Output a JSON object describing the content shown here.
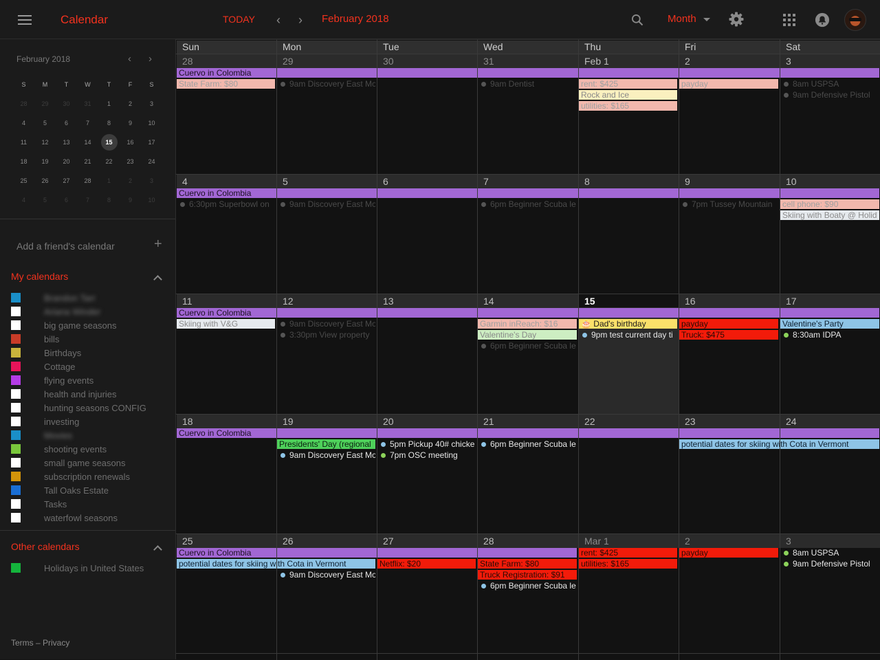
{
  "header": {
    "app_name": "Calendar",
    "today_label": "TODAY",
    "period": "February 2018",
    "view": "Month",
    "prev": "‹",
    "next": "›"
  },
  "mini": {
    "title": "February 2018",
    "weekdays": [
      "S",
      "M",
      "T",
      "W",
      "T",
      "F",
      "S"
    ],
    "weeks": [
      [
        "28",
        "29",
        "30",
        "31",
        "1",
        "2",
        "3"
      ],
      [
        "4",
        "5",
        "6",
        "7",
        "8",
        "9",
        "10"
      ],
      [
        "11",
        "12",
        "13",
        "14",
        "15",
        "16",
        "17"
      ],
      [
        "18",
        "19",
        "20",
        "21",
        "22",
        "23",
        "24"
      ],
      [
        "25",
        "26",
        "27",
        "28",
        "1",
        "2",
        "3"
      ],
      [
        "4",
        "5",
        "6",
        "7",
        "8",
        "9",
        "10"
      ]
    ],
    "selected": "15"
  },
  "sidebar": {
    "add_friend": "Add a friend's calendar",
    "my_calendars": "My calendars",
    "other_calendars": "Other calendars",
    "terms": "Terms – Privacy",
    "my": [
      {
        "label": "Brandon Tarr",
        "color": "#1a8fc8",
        "blurred": true
      },
      {
        "label": "Ariana Winder",
        "color": "#ffffff",
        "blurred": true
      },
      {
        "label": "big game seasons",
        "color": "#ffffff"
      },
      {
        "label": "bills",
        "color": "#c83c28"
      },
      {
        "label": "Birthdays",
        "color": "#c8b43c"
      },
      {
        "label": "Cottage",
        "color": "#e8145a"
      },
      {
        "label": "flying events",
        "color": "#b43ce6"
      },
      {
        "label": "health and injuries",
        "color": "#ffffff"
      },
      {
        "label": "hunting seasons CONFIG",
        "color": "#ffffff"
      },
      {
        "label": "investing",
        "color": "#ffffff"
      },
      {
        "label": "Movies",
        "color": "#1a8fc8",
        "blurred": true
      },
      {
        "label": "shooting events",
        "color": "#7ac83c"
      },
      {
        "label": "small game seasons",
        "color": "#ffffff"
      },
      {
        "label": "subscription renewals",
        "color": "#d4940a"
      },
      {
        "label": "Tall Oaks Estate",
        "color": "#1a6ed4"
      },
      {
        "label": "Tasks",
        "color": "#ffffff"
      },
      {
        "label": "waterfowl seasons",
        "color": "#ffffff"
      }
    ],
    "other": [
      {
        "label": "Holidays in United States",
        "color": "#14b43c"
      }
    ]
  },
  "grid": {
    "day_names": [
      "Sun",
      "Mon",
      "Tue",
      "Wed",
      "Thu",
      "Fri",
      "Sat"
    ],
    "weeks": [
      {
        "days": [
          "28",
          "29",
          "30",
          "31",
          "Feb 1",
          "2",
          "3"
        ],
        "dim": [
          true,
          true,
          true,
          true,
          false,
          false,
          false
        ],
        "events": [
          {
            "row": 0,
            "start": 0,
            "span": 7,
            "text": "Cuervo in Colombia",
            "style": "purple"
          },
          {
            "row": 1,
            "start": 0,
            "span": 1,
            "text": "State Farm: $80",
            "style": "pinkpast"
          },
          {
            "row": 1,
            "start": 1,
            "span": 1,
            "text": "9am Discovery East Mo",
            "style": "dotpast",
            "dot": "#555"
          },
          {
            "row": 1,
            "start": 3,
            "span": 1,
            "text": "9am Dentist",
            "style": "dotpast",
            "dot": "#555"
          },
          {
            "row": 1,
            "start": 4,
            "span": 1,
            "text": "rent: $425",
            "style": "pinkpast"
          },
          {
            "row": 2,
            "start": 4,
            "span": 1,
            "text": "Rock and Ice",
            "style": "yellowpast"
          },
          {
            "row": 3,
            "start": 4,
            "span": 1,
            "text": "utilities: $165",
            "style": "pinkpast"
          },
          {
            "row": 1,
            "start": 5,
            "span": 1,
            "text": "payday",
            "style": "pinkpast"
          },
          {
            "row": 1,
            "start": 6,
            "span": 1,
            "text": "8am USPSA",
            "style": "dotpast",
            "dot": "#555"
          },
          {
            "row": 2,
            "start": 6,
            "span": 1,
            "text": "9am Defensive Pistol",
            "style": "dotpast",
            "dot": "#555"
          }
        ]
      },
      {
        "days": [
          "4",
          "5",
          "6",
          "7",
          "8",
          "9",
          "10"
        ],
        "dim": [
          false,
          false,
          false,
          false,
          false,
          false,
          false
        ],
        "events": [
          {
            "row": 0,
            "start": 0,
            "span": 7,
            "text": "Cuervo in Colombia",
            "style": "purple"
          },
          {
            "row": 1,
            "start": 0,
            "span": 1,
            "text": "6:30pm Superbowl on",
            "style": "dotpast",
            "dot": "#555"
          },
          {
            "row": 1,
            "start": 1,
            "span": 1,
            "text": "9am Discovery East Mo",
            "style": "dotpast",
            "dot": "#555"
          },
          {
            "row": 1,
            "start": 3,
            "span": 1,
            "text": "6pm Beginner Scuba le",
            "style": "dotpast",
            "dot": "#555"
          },
          {
            "row": 1,
            "start": 5,
            "span": 1,
            "text": "7pm Tussey Mountain",
            "style": "dotpast",
            "dot": "#555"
          },
          {
            "row": 1,
            "start": 6,
            "span": 1,
            "text": "cell phone: $90",
            "style": "pinkpast"
          },
          {
            "row": 2,
            "start": 6,
            "span": 1,
            "text": "Skiing with Boaty @ Holid",
            "style": "whitepast"
          }
        ]
      },
      {
        "days": [
          "11",
          "12",
          "13",
          "14",
          "15",
          "16",
          "17"
        ],
        "dim": [
          false,
          false,
          false,
          false,
          false,
          false,
          false
        ],
        "today": 4,
        "events": [
          {
            "row": 0,
            "start": 0,
            "span": 7,
            "text": "Cuervo in Colombia",
            "style": "purple"
          },
          {
            "row": 1,
            "start": 0,
            "span": 1,
            "text": "Skiing with V&G",
            "style": "whitepast"
          },
          {
            "row": 1,
            "start": 1,
            "span": 1,
            "text": "9am Discovery East Mo",
            "style": "dotpast",
            "dot": "#555"
          },
          {
            "row": 2,
            "start": 1,
            "span": 1,
            "text": "3:30pm View property",
            "style": "dotpast",
            "dot": "#555"
          },
          {
            "row": 1,
            "start": 3,
            "span": 1,
            "text": "Garmin inReach: $16",
            "style": "pinkpast"
          },
          {
            "row": 2,
            "start": 3,
            "span": 1,
            "text": "Valentine's Day",
            "style": "greenpast"
          },
          {
            "row": 3,
            "start": 3,
            "span": 1,
            "text": "6pm Beginner Scuba le",
            "style": "dotpast",
            "dot": "#555"
          },
          {
            "row": 1,
            "start": 4,
            "span": 1,
            "text": "🎂 Dad's birthday",
            "style": "gold"
          },
          {
            "row": 2,
            "start": 4,
            "span": 1,
            "text": "9pm test current day ti",
            "style": "dot",
            "dot": "#8ec4e6"
          },
          {
            "row": 1,
            "start": 5,
            "span": 1,
            "text": "payday",
            "style": "red"
          },
          {
            "row": 2,
            "start": 5,
            "span": 1,
            "text": "Truck: $475",
            "style": "red"
          },
          {
            "row": 1,
            "start": 6,
            "span": 1,
            "text": "Valentine's Party",
            "style": "blue"
          },
          {
            "row": 2,
            "start": 6,
            "span": 1,
            "text": "8:30am IDPA",
            "style": "dot",
            "dot": "#8cd25a"
          }
        ]
      },
      {
        "days": [
          "18",
          "19",
          "20",
          "21",
          "22",
          "23",
          "24"
        ],
        "dim": [
          false,
          false,
          false,
          false,
          false,
          false,
          false
        ],
        "events": [
          {
            "row": 0,
            "start": 0,
            "span": 7,
            "text": "Cuervo in Colombia",
            "style": "purple"
          },
          {
            "row": 1,
            "start": 1,
            "span": 1,
            "text": "Presidents' Day (regional",
            "style": "green"
          },
          {
            "row": 2,
            "start": 1,
            "span": 1,
            "text": "9am Discovery East Mo",
            "style": "dot",
            "dot": "#8ec4e6"
          },
          {
            "row": 1,
            "start": 2,
            "span": 1,
            "text": "5pm Pickup 40# chicke",
            "style": "dot",
            "dot": "#8ec4e6"
          },
          {
            "row": 2,
            "start": 2,
            "span": 1,
            "text": "7pm OSC meeting",
            "style": "dot",
            "dot": "#8cd25a"
          },
          {
            "row": 1,
            "start": 3,
            "span": 1,
            "text": "6pm Beginner Scuba le",
            "style": "dot",
            "dot": "#8ec4e6"
          },
          {
            "row": 1,
            "start": 5,
            "span": 2,
            "text": "potential dates for skiing with Cota in Vermont",
            "style": "blue"
          }
        ]
      },
      {
        "days": [
          "25",
          "26",
          "27",
          "28",
          "Mar 1",
          "2",
          "3"
        ],
        "dim": [
          false,
          false,
          false,
          false,
          true,
          true,
          true
        ],
        "events": [
          {
            "row": 0,
            "start": 0,
            "span": 4,
            "text": "Cuervo in Colombia",
            "style": "purple"
          },
          {
            "row": 1,
            "start": 0,
            "span": 2,
            "text": "potential dates for skiing with Cota in Vermont",
            "style": "blue"
          },
          {
            "row": 2,
            "start": 1,
            "span": 1,
            "text": "9am Discovery East Mo",
            "style": "dot",
            "dot": "#8ec4e6"
          },
          {
            "row": 1,
            "start": 2,
            "span": 1,
            "text": "Netflix: $20",
            "style": "red"
          },
          {
            "row": 1,
            "start": 3,
            "span": 1,
            "text": "State Farm: $80",
            "style": "red"
          },
          {
            "row": 2,
            "start": 3,
            "span": 1,
            "text": "Truck Registration: $91",
            "style": "red"
          },
          {
            "row": 3,
            "start": 3,
            "span": 1,
            "text": "6pm Beginner Scuba le",
            "style": "dot",
            "dot": "#8ec4e6"
          },
          {
            "row": 0,
            "start": 4,
            "span": 1,
            "text": "rent: $425",
            "style": "red"
          },
          {
            "row": 1,
            "start": 4,
            "span": 1,
            "text": "utilities: $165",
            "style": "red"
          },
          {
            "row": 0,
            "start": 5,
            "span": 1,
            "text": "payday",
            "style": "red"
          },
          {
            "row": 0,
            "start": 6,
            "span": 1,
            "text": "8am USPSA",
            "style": "dot",
            "dot": "#8cd25a"
          },
          {
            "row": 1,
            "start": 6,
            "span": 1,
            "text": "9am Defensive Pistol",
            "style": "dot",
            "dot": "#8cd25a"
          }
        ]
      }
    ]
  }
}
